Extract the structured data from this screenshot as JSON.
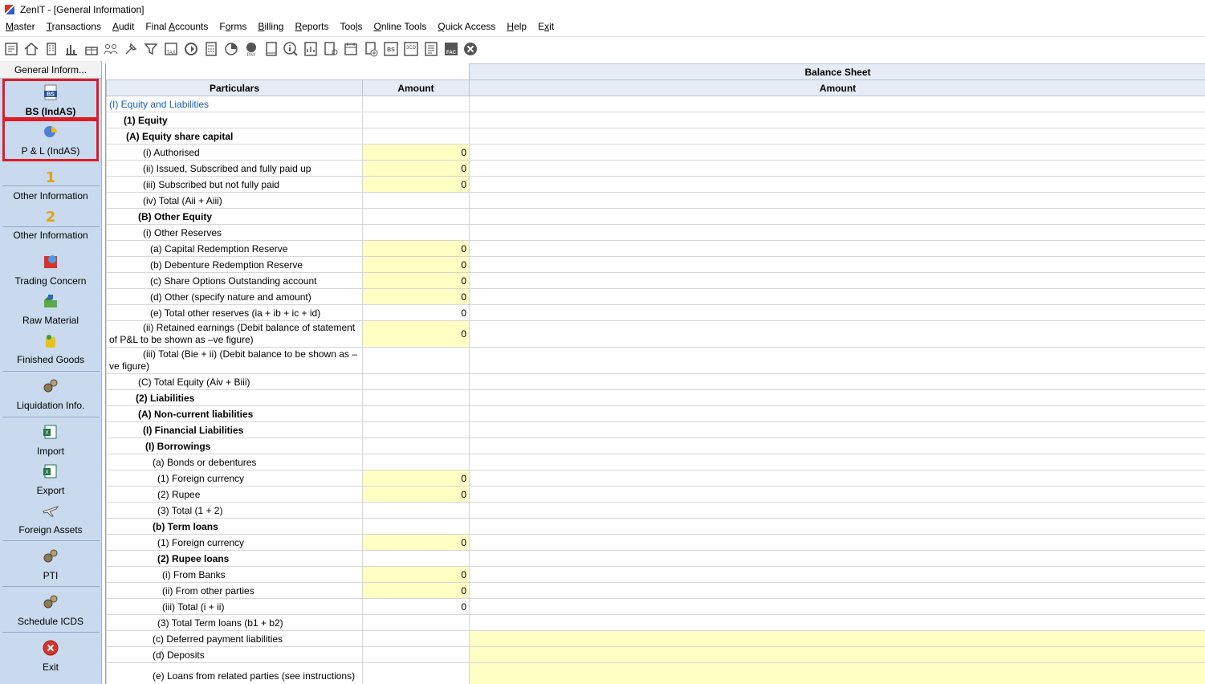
{
  "window": {
    "title": "ZenIT - [General Information]"
  },
  "menu": [
    {
      "pre": "",
      "ul": "M",
      "post": "aster"
    },
    {
      "pre": "",
      "ul": "T",
      "post": "ransactions"
    },
    {
      "pre": "",
      "ul": "A",
      "post": "udit"
    },
    {
      "pre": "Final ",
      "ul": "A",
      "post": "ccounts"
    },
    {
      "pre": "F",
      "ul": "o",
      "post": "rms"
    },
    {
      "pre": "",
      "ul": "B",
      "post": "illing"
    },
    {
      "pre": "",
      "ul": "R",
      "post": "eports"
    },
    {
      "pre": "Too",
      "ul": "l",
      "post": "s"
    },
    {
      "pre": "",
      "ul": "O",
      "post": "nline Tools"
    },
    {
      "pre": "",
      "ul": "Q",
      "post": "uick Access"
    },
    {
      "pre": "",
      "ul": "H",
      "post": "elp"
    },
    {
      "pre": "E",
      "ul": "x",
      "post": "it"
    }
  ],
  "toolbar": [
    "print-icon",
    "home-icon",
    "building-icon",
    "bar-chart-icon",
    "gift-icon",
    "users-icon",
    "pin-icon",
    "filter-icon",
    "tax-icon",
    "refresh-icon",
    "calculator-icon",
    "pie-icon",
    "pay-icon",
    "book-icon",
    "info-icon",
    "report-icon",
    "person-doc-icon",
    "calendar-icon",
    "add-doc-icon",
    "bs-icon",
    "3cd-icon",
    "ledger-icon",
    "fac-icon",
    "close-circle-icon"
  ],
  "toolbar_labels": {
    "tax": "TAX",
    "pay": "PAY",
    "bs": "BS",
    "cd": "3CD",
    "fac": "FAC"
  },
  "sidebar": {
    "header": "General Inform...",
    "items": [
      {
        "label": "BS (IndAS)",
        "icon": "bs-doc-icon",
        "bold": true
      },
      {
        "label": "P & L (IndAS)",
        "icon": "pie-chart-icon"
      },
      {
        "label": "Other Information",
        "icon": "number-1-icon",
        "badge": "1"
      },
      {
        "label": "Other Information",
        "icon": "number-2-icon",
        "badge": "2"
      },
      {
        "label": "Trading Concern",
        "icon": "globe-book-icon"
      },
      {
        "label": "Raw Material",
        "icon": "factory-icon"
      },
      {
        "label": "Finished Goods",
        "icon": "goods-bag-icon"
      },
      {
        "label": "Liquidation Info.",
        "icon": "gears-icon"
      },
      {
        "label": "Import",
        "icon": "excel-import-icon"
      },
      {
        "label": "Export",
        "icon": "excel-export-icon"
      },
      {
        "label": "Foreign Assets",
        "icon": "airplane-icon"
      },
      {
        "label": "PTI",
        "icon": "gears-icon"
      },
      {
        "label": "Schedule ICDS",
        "icon": "gears-icon"
      },
      {
        "label": "Exit",
        "icon": "exit-icon"
      }
    ]
  },
  "grid": {
    "title": "Balance Sheet",
    "headers": [
      "Particulars",
      "Amount",
      "Amount"
    ],
    "rows": [
      {
        "text": "(I) Equity and Liabilities",
        "indent": 0,
        "style": "blue"
      },
      {
        "text": "(1) Equity",
        "indent": 18,
        "style": "bold"
      },
      {
        "text": "(A) Equity share capital",
        "indent": 21,
        "style": "bold"
      },
      {
        "text": "(i) Authorised",
        "indent": 42,
        "amount": "0",
        "input": true
      },
      {
        "text": "(ii) Issued, Subscribed and fully paid up",
        "indent": 42,
        "amount": "0",
        "input": true
      },
      {
        "text": "(iii) Subscribed but not fully paid",
        "indent": 42,
        "amount": "0",
        "input": true
      },
      {
        "text": "(iv) Total (Aii + Aiii)",
        "indent": 42
      },
      {
        "text": "(B) Other Equity",
        "indent": 36,
        "style": "bold"
      },
      {
        "text": "(i) Other Reserves",
        "indent": 42
      },
      {
        "text": "(a) Capital Redemption Reserve",
        "indent": 51,
        "amount": "0",
        "input": true
      },
      {
        "text": "(b) Debenture Redemption Reserve",
        "indent": 51,
        "amount": "0",
        "input": true
      },
      {
        "text": "(c) Share Options Outstanding account",
        "indent": 51,
        "amount": "0",
        "input": true
      },
      {
        "text": "(d) Other (specify nature and amount)",
        "indent": 51,
        "amount": "0",
        "input": true
      },
      {
        "text": "(e) Total other reserves (ia + ib + ic + id)",
        "indent": 51,
        "amount": "0"
      },
      {
        "text": "(ii) Retained earnings (Debit balance of statement of P&L to be shown as –ve figure)",
        "indent": 42,
        "amount": "0",
        "input": true,
        "tall": true
      },
      {
        "text": "(iii) Total (Bie + ii) (Debit balance to be shown as –ve figure)",
        "indent": 42,
        "tall": true
      },
      {
        "text": "(C) Total Equity (Aiv + Biii)",
        "indent": 36
      },
      {
        "text": "(2) Liabilities",
        "indent": 33,
        "style": "bold"
      },
      {
        "text": "(A) Non-current liabilities",
        "indent": 36,
        "style": "bold"
      },
      {
        "text": "(I) Financial Liabilities",
        "indent": 42,
        "style": "bold"
      },
      {
        "text": "(I) Borrowings",
        "indent": 45,
        "style": "bold"
      },
      {
        "text": "(a) Bonds or debentures",
        "indent": 54
      },
      {
        "text": "(1) Foreign currency",
        "indent": 60,
        "amount": "0",
        "input": true
      },
      {
        "text": "(2) Rupee",
        "indent": 60,
        "amount": "0",
        "input": true
      },
      {
        "text": "(3) Total (1 + 2)",
        "indent": 60
      },
      {
        "text": "(b) Term loans",
        "indent": 54,
        "style": "bold"
      },
      {
        "text": "(1) Foreign currency",
        "indent": 60,
        "amount": "0",
        "input": true
      },
      {
        "text": "(2) Rupee loans",
        "indent": 60,
        "style": "bold"
      },
      {
        "text": "(i) From Banks",
        "indent": 66,
        "amount": "0",
        "input": true
      },
      {
        "text": "(ii) From other parties",
        "indent": 66,
        "amount": "0",
        "input": true
      },
      {
        "text": "(iii) Total (i + ii)",
        "indent": 66,
        "amount": "0"
      },
      {
        "text": "(3) Total Term loans (b1 + b2)",
        "indent": 60
      },
      {
        "text": "(c) Deferred payment liabilities",
        "indent": 54,
        "wideinput": true
      },
      {
        "text": "(d) Deposits",
        "indent": 54,
        "wideinput": true
      },
      {
        "text": "(e) Loans from related parties (see instructions)",
        "indent": 54,
        "wideinput": true,
        "tall": true
      }
    ]
  }
}
